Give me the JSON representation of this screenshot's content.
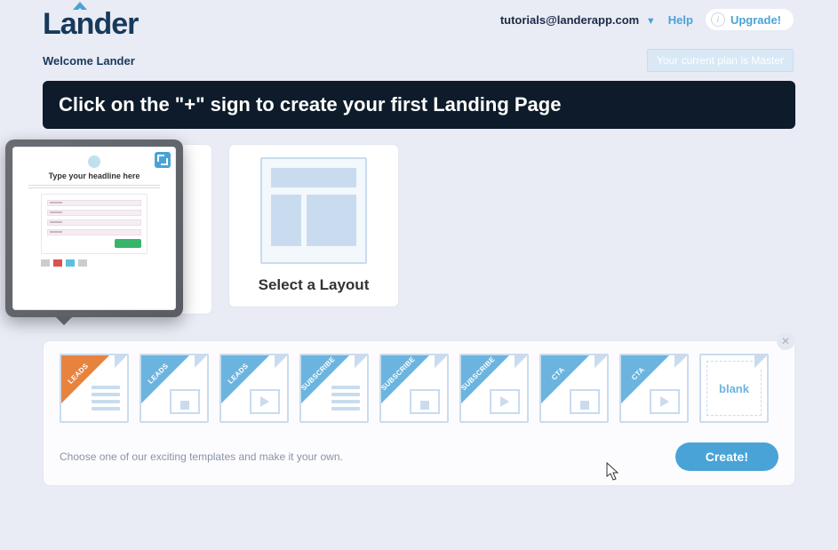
{
  "topbar": {
    "email": "tutorials@landerapp.com",
    "help": "Help",
    "upgrade": "Upgrade!"
  },
  "logo": {
    "text": "Lander"
  },
  "welcome": "Welcome Lander",
  "plan_badge": "Your current plan is Master",
  "hero": "Click on the \"+\" sign to create your first Landing Page",
  "preview": {
    "headline": "Type your headline here"
  },
  "layout_card": {
    "title": "Select a Layout"
  },
  "templates": [
    {
      "ribbon": "LEADS",
      "kind": "form",
      "selected": true
    },
    {
      "ribbon": "LEADS",
      "kind": "img"
    },
    {
      "ribbon": "LEADS",
      "kind": "play"
    },
    {
      "ribbon": "SUBSCRIBE",
      "kind": "form"
    },
    {
      "ribbon": "SUBSCRIBE",
      "kind": "img"
    },
    {
      "ribbon": "SUBSCRIBE",
      "kind": "play"
    },
    {
      "ribbon": "CTA",
      "kind": "img"
    },
    {
      "ribbon": "CTA",
      "kind": "play"
    },
    {
      "ribbon": "",
      "kind": "blank",
      "blank_label": "blank"
    }
  ],
  "footer_hint": "Choose one of our exciting templates and make it your own.",
  "create_button": "Create!"
}
